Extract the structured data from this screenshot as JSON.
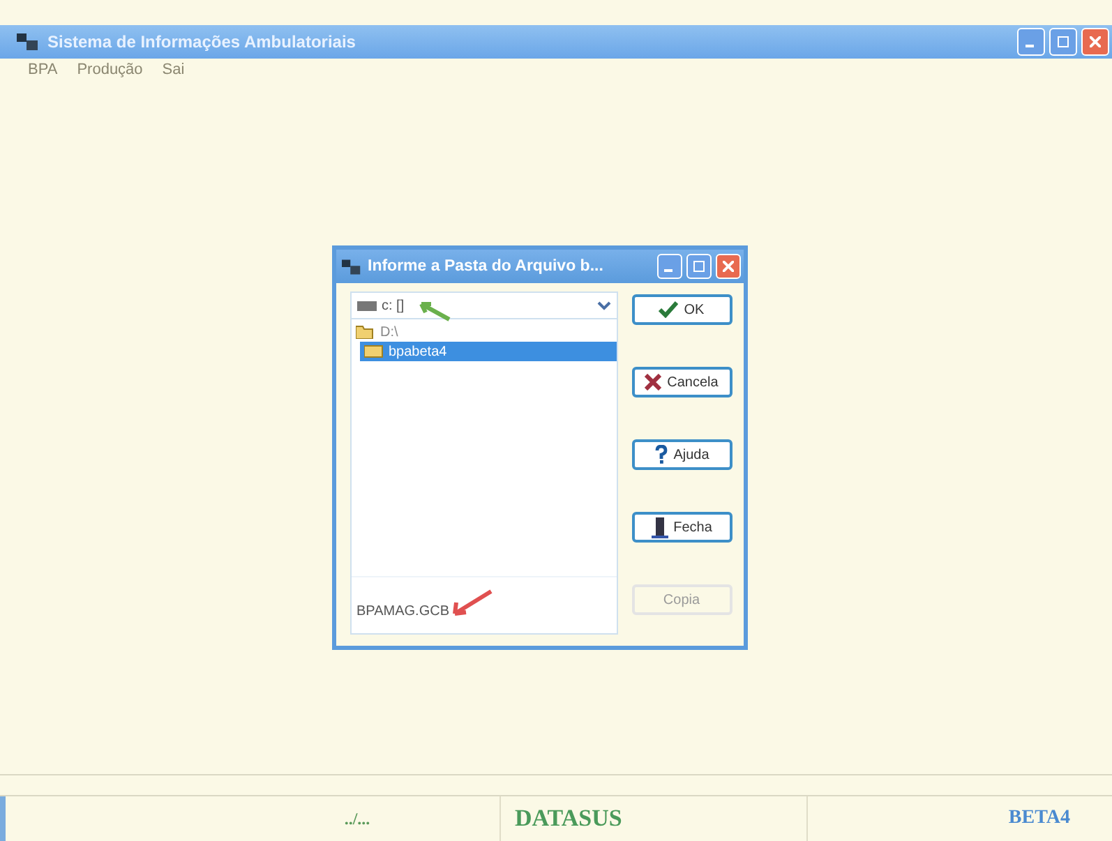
{
  "window": {
    "title": "Sistema de Informações Ambulatoriais"
  },
  "menu": [
    {
      "label": "BPA"
    },
    {
      "label": "Produção"
    },
    {
      "label": "Sai"
    }
  ],
  "dialog": {
    "title": "Informe a Pasta do Arquivo b...",
    "drive": "c: []",
    "folders": [
      {
        "label": "D:\\",
        "kind": "open",
        "selected": false,
        "children": [
          {
            "label": "bpabeta4",
            "kind": "closed",
            "selected": true
          }
        ]
      }
    ],
    "file": "BPAMAG.GCB",
    "buttons": [
      {
        "label": "OK",
        "kind": "ok",
        "disabled": false
      },
      {
        "label": "Cancela",
        "kind": "cancel",
        "disabled": false
      },
      {
        "label": "Ajuda",
        "kind": "help",
        "disabled": false
      },
      {
        "label": "Fecha",
        "kind": "close",
        "disabled": false
      },
      {
        "label": "Copia",
        "kind": "plain",
        "disabled": true
      }
    ]
  },
  "status_bar": [
    "../...",
    "DATASUS",
    "BETA4"
  ]
}
